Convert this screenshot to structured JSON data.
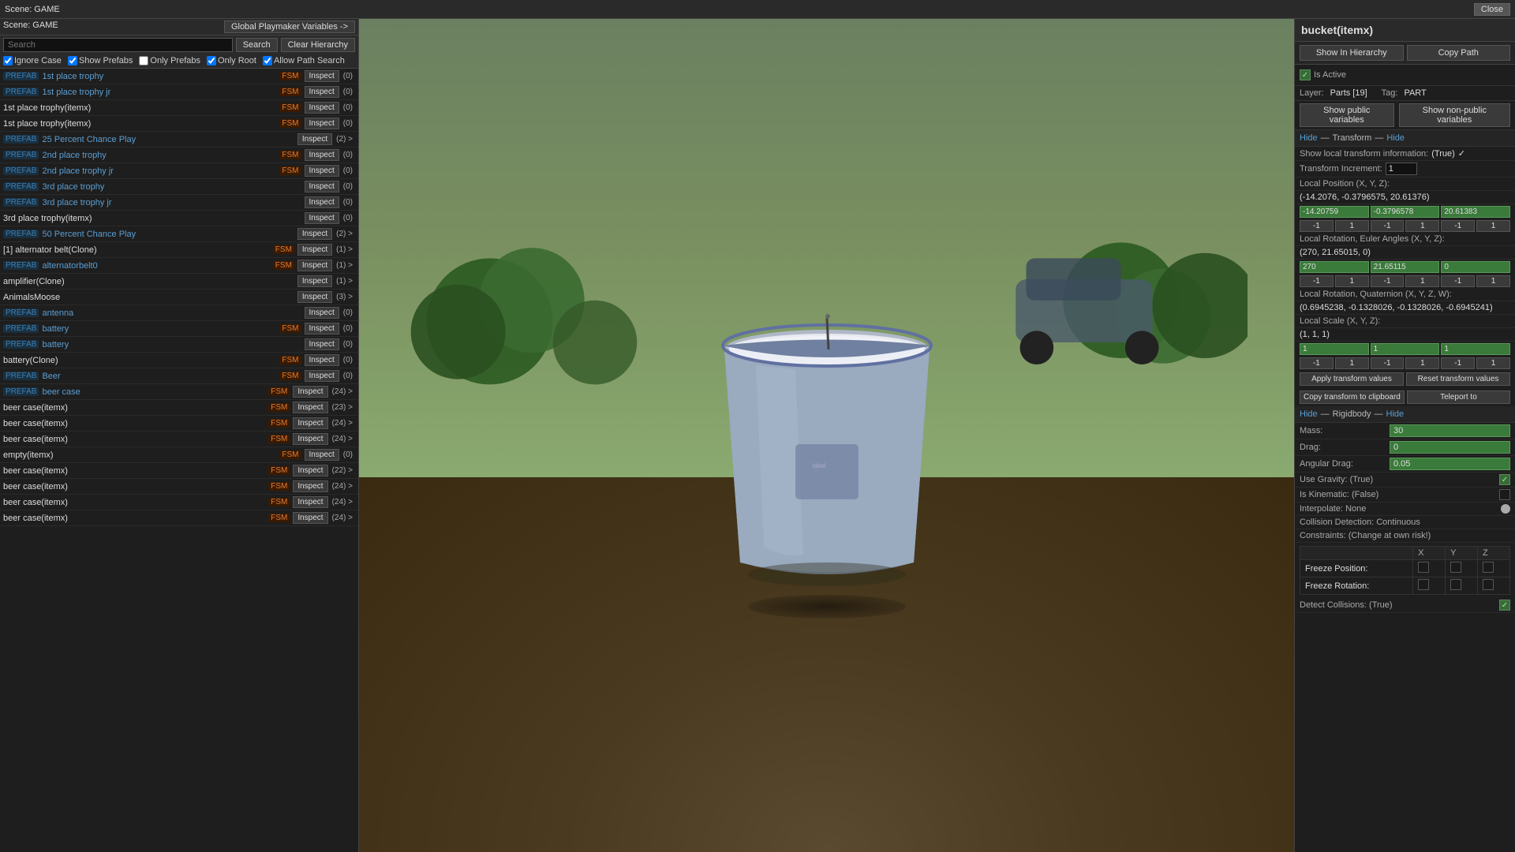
{
  "topBar": {
    "sceneLabel": "Scene: GAME",
    "closeLabel": "Close"
  },
  "leftPanel": {
    "sceneTitle": "Scene: GAME",
    "playmakerBtn": "Global Playmaker Variables ->",
    "searchPlaceholder": "Search",
    "searchBtn": "Search",
    "clearBtn": "Clear Hierarchy",
    "options": [
      {
        "id": "ignore-case",
        "label": "Ignore Case",
        "checked": true
      },
      {
        "id": "show-prefabs",
        "label": "Show Prefabs",
        "checked": true
      },
      {
        "id": "only-prefabs",
        "label": "Only Prefabs",
        "checked": false
      },
      {
        "id": "only-root",
        "label": "Only Root",
        "checked": true
      },
      {
        "id": "allow-path-search",
        "label": "Allow Path Search",
        "checked": true
      }
    ],
    "items": [
      {
        "prefab": true,
        "name": "1st place trophy",
        "fsm": true,
        "inspect": "Inspect",
        "count": "(0)"
      },
      {
        "prefab": true,
        "name": "1st place trophy jr",
        "fsm": true,
        "inspect": "Inspect",
        "count": "(0)"
      },
      {
        "prefab": false,
        "name": "1st place trophy(itemx)",
        "fsm": true,
        "inspect": "Inspect",
        "count": "(0)"
      },
      {
        "prefab": false,
        "name": "1st place trophy(itemx)",
        "fsm": true,
        "inspect": "Inspect",
        "count": "(0)"
      },
      {
        "prefab": true,
        "name": "25 Percent Chance Play",
        "fsm": false,
        "inspect": "Inspect",
        "count": "(2) >"
      },
      {
        "prefab": true,
        "name": "2nd place trophy",
        "fsm": true,
        "inspect": "Inspect",
        "count": "(0)"
      },
      {
        "prefab": true,
        "name": "2nd place trophy jr",
        "fsm": true,
        "inspect": "Inspect",
        "count": "(0)"
      },
      {
        "prefab": true,
        "name": "3rd place trophy",
        "fsm": false,
        "inspect": "Inspect",
        "count": "(0)"
      },
      {
        "prefab": true,
        "name": "3rd place trophy jr",
        "fsm": false,
        "inspect": "Inspect",
        "count": "(0)"
      },
      {
        "prefab": false,
        "name": "3rd place trophy(itemx)",
        "fsm": false,
        "inspect": "Inspect",
        "count": "(0)"
      },
      {
        "prefab": true,
        "name": "50 Percent Chance Play",
        "fsm": false,
        "inspect": "Inspect",
        "count": "(2) >"
      },
      {
        "prefab": false,
        "name": "[1] alternator belt(Clone)",
        "fsm": true,
        "inspect": "Inspect",
        "count": "(1) >"
      },
      {
        "prefab": true,
        "name": "alternatorbelt0",
        "fsm": true,
        "inspect": "Inspect",
        "count": "(1) >"
      },
      {
        "prefab": false,
        "name": "amplifier(Clone)",
        "fsm": false,
        "inspect": "Inspect",
        "count": "(1) >"
      },
      {
        "prefab": false,
        "name": "AnimalsMoose",
        "fsm": false,
        "inspect": "Inspect",
        "count": "(3) >"
      },
      {
        "prefab": true,
        "name": "antenna",
        "fsm": false,
        "inspect": "Inspect",
        "count": "(0)"
      },
      {
        "prefab": true,
        "name": "battery",
        "fsm": true,
        "inspect": "Inspect",
        "count": "(0)"
      },
      {
        "prefab": true,
        "name": "battery",
        "fsm": false,
        "inspect": "Inspect",
        "count": "(0)"
      },
      {
        "prefab": false,
        "name": "battery(Clone)",
        "fsm": true,
        "inspect": "Inspect",
        "count": "(0)"
      },
      {
        "prefab": true,
        "name": "Beer",
        "fsm": true,
        "inspect": "Inspect",
        "count": "(0)"
      },
      {
        "prefab": true,
        "name": "beer case",
        "fsm": true,
        "inspect": "Inspect",
        "count": "(24) >"
      },
      {
        "prefab": false,
        "name": "beer case(itemx)",
        "fsm": true,
        "inspect": "Inspect",
        "count": "(23) >"
      },
      {
        "prefab": false,
        "name": "beer case(itemx)",
        "fsm": true,
        "inspect": "Inspect",
        "count": "(24) >"
      },
      {
        "prefab": false,
        "name": "beer case(itemx)",
        "fsm": true,
        "inspect": "Inspect",
        "count": "(24) >"
      },
      {
        "prefab": false,
        "name": "empty(itemx)",
        "fsm": true,
        "inspect": "Inspect",
        "count": "(0)"
      },
      {
        "prefab": false,
        "name": "beer case(itemx)",
        "fsm": true,
        "inspect": "Inspect",
        "count": "(22) >"
      },
      {
        "prefab": false,
        "name": "beer case(itemx)",
        "fsm": true,
        "inspect": "Inspect",
        "count": "(24) >"
      },
      {
        "prefab": false,
        "name": "beer case(itemx)",
        "fsm": true,
        "inspect": "Inspect",
        "count": "(24) >"
      },
      {
        "prefab": false,
        "name": "beer case(itemx)",
        "fsm": true,
        "inspect": "Inspect",
        "count": "(24) >"
      }
    ]
  },
  "inspector": {
    "title": "bucket(itemx)",
    "showInHierarchyBtn": "Show In Hierarchy",
    "copyPathBtn": "Copy Path",
    "isActive": "Is Active",
    "layer": "Parts [19]",
    "tag": "PART",
    "showPublicVarsBtn": "Show public variables",
    "showNonPublicVarsBtn": "Show non-public variables",
    "transformSection": {
      "headerHide1": "Hide",
      "headerLabel": "Transform",
      "headerHide2": "Hide",
      "showLocalTransform": "Show local transform information: (True)",
      "transformIncrement": "Transform Increment:",
      "transformIncrementVal": "1",
      "localPositionLabel": "Local Position (X, Y, Z):",
      "localPositionDesc": "(-14.2076, -0.3796575, 20.61376)",
      "localPosX": "-14.20759",
      "localPosY": "-0.3796578",
      "localPosZ": "20.61383",
      "localRotationLabel": "Local Rotation, Euler Angles (X, Y, Z):",
      "localRotationDesc": "(270, 21.65015, 0)",
      "localRotX": "270",
      "localRotY": "21.65115",
      "localRotZ": "0",
      "localRotQuatLabel": "Local Rotation, Quaternion (X, Y, Z, W):",
      "localRotQuatDesc": "(0.6945238, -0.1328026, -0.1328026, -0.6945241)",
      "localScaleLabel": "Local Scale (X, Y, Z):",
      "localScaleDesc": "(1, 1, 1)",
      "localScaleX": "1",
      "localScaleY": "1",
      "localScaleZ": "1",
      "applyBtn": "Apply transform values",
      "resetBtn": "Reset transform values",
      "copyClipboardBtn": "Copy transform to clipboard",
      "teleportBtn": "Teleport to"
    },
    "rigidbodySection": {
      "headerHide1": "Hide",
      "headerLabel": "Rigidbody",
      "headerHide2": "Hide",
      "massLabel": "Mass:",
      "massVal": "30",
      "dragLabel": "Drag:",
      "dragVal": "0",
      "angularDragLabel": "Angular Drag:",
      "angularDragVal": "0.05",
      "useGravityLabel": "Use Gravity: (True)",
      "isKinematicLabel": "Is Kinematic: (False)",
      "interpolateLabel": "Interpolate: None",
      "collisionDetectionLabel": "Collision Detection: Continuous",
      "constraintsLabel": "Constraints: (Change at own risk!)",
      "freezePositionLabel": "Freeze Position:",
      "freezeRotationLabel": "Freeze Rotation:",
      "freezeHeaders": [
        "",
        "X",
        "Y",
        "Z"
      ],
      "detectCollisionsLabel": "Detect Collisions: (True)"
    }
  },
  "xyzButtons": {
    "negOne": "-1",
    "one": "1"
  }
}
